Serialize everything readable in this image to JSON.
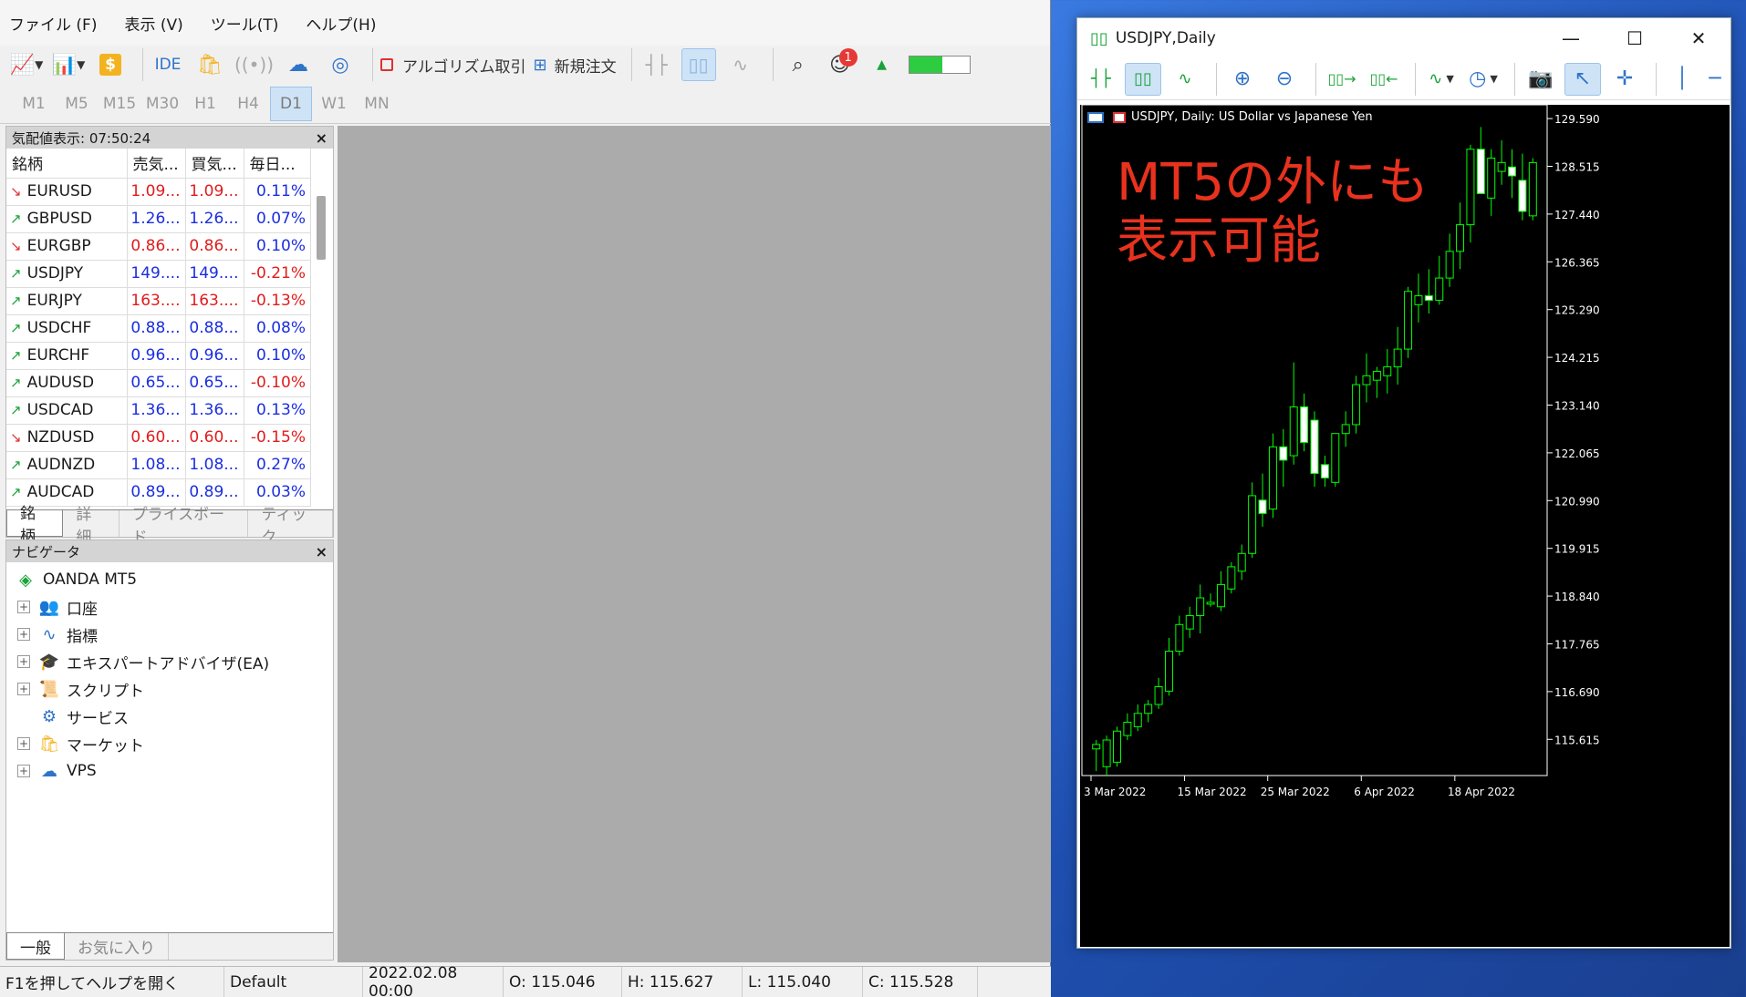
{
  "menu": [
    "ファイル (F)",
    "表示 (V)",
    "ツール(T)",
    "ヘルプ(H)"
  ],
  "toolbar": {
    "ide": "IDE",
    "algo": "アルゴリズム取引",
    "new_order": "新規注文",
    "notification_count": "1"
  },
  "timeframes": [
    "M1",
    "M5",
    "M15",
    "M30",
    "H1",
    "H4",
    "D1",
    "W1",
    "MN"
  ],
  "active_timeframe": "D1",
  "market_watch": {
    "title": "気配値表示: 07:50:24",
    "columns": [
      "銘柄",
      "売気...",
      "買気...",
      "毎日..."
    ],
    "rows": [
      {
        "symbol": "EURUSD",
        "bid": "1.09...",
        "ask": "1.09...",
        "change": "0.11%",
        "dir": "down",
        "bid_color": "red"
      },
      {
        "symbol": "GBPUSD",
        "bid": "1.26...",
        "ask": "1.26...",
        "change": "0.07%",
        "dir": "up",
        "bid_color": "blue"
      },
      {
        "symbol": "EURGBP",
        "bid": "0.86...",
        "ask": "0.86...",
        "change": "0.10%",
        "dir": "down",
        "bid_color": "red"
      },
      {
        "symbol": "USDJPY",
        "bid": "149....",
        "ask": "149....",
        "change": "-0.21%",
        "dir": "up",
        "bid_color": "blue"
      },
      {
        "symbol": "EURJPY",
        "bid": "163....",
        "ask": "163....",
        "change": "-0.13%",
        "dir": "up",
        "bid_color": "red"
      },
      {
        "symbol": "USDCHF",
        "bid": "0.88...",
        "ask": "0.88...",
        "change": "0.08%",
        "dir": "up",
        "bid_color": "blue"
      },
      {
        "symbol": "EURCHF",
        "bid": "0.96...",
        "ask": "0.96...",
        "change": "0.10%",
        "dir": "up",
        "bid_color": "blue"
      },
      {
        "symbol": "AUDUSD",
        "bid": "0.65...",
        "ask": "0.65...",
        "change": "-0.10%",
        "dir": "up",
        "bid_color": "blue"
      },
      {
        "symbol": "USDCAD",
        "bid": "1.36...",
        "ask": "1.36...",
        "change": "0.13%",
        "dir": "up",
        "bid_color": "blue"
      },
      {
        "symbol": "NZDUSD",
        "bid": "0.60...",
        "ask": "0.60...",
        "change": "-0.15%",
        "dir": "down",
        "bid_color": "red"
      },
      {
        "symbol": "AUDNZD",
        "bid": "1.08...",
        "ask": "1.08...",
        "change": "0.27%",
        "dir": "up",
        "bid_color": "blue"
      },
      {
        "symbol": "AUDCAD",
        "bid": "0.89...",
        "ask": "0.89...",
        "change": "0.03%",
        "dir": "up",
        "bid_color": "blue"
      }
    ],
    "tabs": [
      "銘柄",
      "詳細",
      "プライスボード",
      "ティック"
    ]
  },
  "navigator": {
    "title": "ナビゲータ",
    "root": "OANDA MT5",
    "items": [
      "口座",
      "指標",
      "エキスパートアドバイザ(EA)",
      "スクリプト",
      "サービス",
      "マーケット",
      "VPS"
    ],
    "tabs": [
      "一般",
      "お気に入り"
    ]
  },
  "status": {
    "help": "F1を押してヘルプを開く",
    "profile": "Default",
    "datetime": "2022.02.08 00:00",
    "open": "O: 115.046",
    "high": "H: 115.627",
    "low": "L: 115.040",
    "close": "C: 115.528"
  },
  "chart_window": {
    "title": "USDJPY,Daily",
    "header": "USDJPY, Daily:  US Dollar vs Japanese Yen",
    "overlay_line1": "MT5の外にも",
    "overlay_line2": "表示可能",
    "colors": {
      "bull": "#000000",
      "bear": "#ffffff",
      "outline": "#00ff00",
      "overlay": "#e8321e"
    }
  },
  "chart_data": {
    "type": "candlestick",
    "title": "USDJPY, Daily:  US Dollar vs Japanese Yen",
    "ylim": [
      114.8,
      129.9
    ],
    "y_ticks": [
      "129.590",
      "128.515",
      "127.440",
      "126.365",
      "125.290",
      "124.215",
      "123.140",
      "122.065",
      "120.990",
      "119.915",
      "118.840",
      "117.765",
      "116.690",
      "115.615"
    ],
    "x_ticks": [
      "3 Mar 2022",
      "15 Mar 2022",
      "25 Mar 2022",
      "6 Apr 2022",
      "18 Apr 2022"
    ],
    "candles": [
      [
        115.4,
        115.6,
        114.9,
        115.5
      ],
      [
        115.0,
        115.7,
        114.8,
        115.6
      ],
      [
        115.1,
        115.9,
        115.0,
        115.8
      ],
      [
        115.7,
        116.2,
        115.6,
        116.0
      ],
      [
        115.9,
        116.4,
        115.8,
        116.2
      ],
      [
        116.2,
        116.5,
        116.0,
        116.4
      ],
      [
        116.4,
        117.0,
        116.3,
        116.8
      ],
      [
        116.7,
        117.9,
        116.6,
        117.6
      ],
      [
        117.6,
        118.4,
        117.5,
        118.2
      ],
      [
        118.1,
        118.6,
        117.9,
        118.4
      ],
      [
        118.4,
        119.1,
        118.0,
        118.8
      ],
      [
        118.7,
        118.9,
        118.6,
        118.7
      ],
      [
        118.6,
        119.4,
        118.5,
        119.1
      ],
      [
        119.0,
        119.6,
        118.9,
        119.5
      ],
      [
        119.4,
        120.0,
        119.2,
        119.8
      ],
      [
        119.8,
        121.4,
        119.7,
        121.1
      ],
      [
        121.0,
        121.6,
        120.4,
        120.7
      ],
      [
        120.8,
        122.5,
        120.6,
        122.2
      ],
      [
        122.2,
        122.6,
        121.3,
        121.9
      ],
      [
        122.0,
        124.1,
        121.8,
        123.1
      ],
      [
        123.1,
        123.4,
        122.1,
        122.3
      ],
      [
        122.8,
        123.0,
        121.3,
        121.6
      ],
      [
        121.8,
        122.0,
        121.3,
        121.5
      ],
      [
        121.4,
        122.5,
        121.3,
        122.5
      ],
      [
        122.5,
        123.0,
        122.2,
        122.7
      ],
      [
        122.7,
        123.8,
        122.5,
        123.6
      ],
      [
        123.6,
        124.3,
        123.2,
        123.8
      ],
      [
        123.7,
        124.0,
        123.3,
        123.9
      ],
      [
        123.8,
        124.4,
        123.4,
        124.0
      ],
      [
        124.0,
        124.9,
        123.6,
        124.4
      ],
      [
        124.4,
        125.8,
        124.2,
        125.7
      ],
      [
        125.4,
        126.1,
        125.0,
        125.6
      ],
      [
        125.6,
        126.2,
        125.2,
        125.5
      ],
      [
        125.5,
        126.5,
        125.4,
        126.0
      ],
      [
        126.0,
        127.0,
        125.8,
        126.6
      ],
      [
        126.6,
        127.7,
        126.2,
        127.2
      ],
      [
        127.2,
        129.0,
        126.8,
        128.9
      ],
      [
        128.9,
        129.4,
        127.9,
        127.9
      ],
      [
        127.8,
        128.9,
        127.4,
        128.7
      ],
      [
        128.4,
        129.1,
        128.1,
        128.6
      ],
      [
        128.5,
        128.9,
        127.8,
        128.3
      ],
      [
        128.2,
        128.8,
        127.3,
        127.5
      ],
      [
        127.4,
        128.7,
        127.3,
        128.6
      ]
    ]
  }
}
